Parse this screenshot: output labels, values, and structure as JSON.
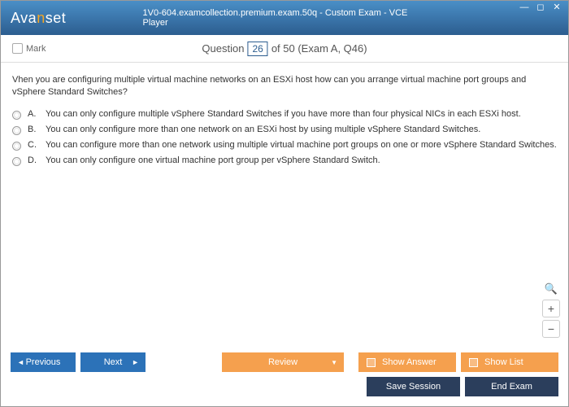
{
  "titlebar": {
    "logo_pre": "Ava",
    "logo_n": "n",
    "logo_post": "set",
    "title": "1V0-604.examcollection.premium.exam.50q - Custom Exam - VCE Player"
  },
  "header": {
    "mark_label": "Mark",
    "q_word": "Question",
    "q_num": "26",
    "q_rest": " of 50 (Exam A, Q46)"
  },
  "question": {
    "text": "Vhen you are configuring multiple virtual machine networks on an ESXi host how can you arrange virtual machine port groups and vSphere Standard Switches?",
    "options": [
      {
        "label": "A.",
        "text": "You can only configure multiple vSphere Standard Switches if you have more than four physical NICs in each ESXi host."
      },
      {
        "label": "B.",
        "text": "You can only configure more than one network on an ESXi host by using multiple vSphere Standard Switches."
      },
      {
        "label": "C.",
        "text": "You can configure more than one network using multiple virtual machine port groups on one or more vSphere Standard Switches."
      },
      {
        "label": "D.",
        "text": "You can only configure one virtual machine port group per vSphere Standard Switch."
      }
    ]
  },
  "footer": {
    "previous": "Previous",
    "next": "Next",
    "review": "Review",
    "show_answer": "Show Answer",
    "show_list": "Show List",
    "save_session": "Save Session",
    "end_exam": "End Exam"
  }
}
